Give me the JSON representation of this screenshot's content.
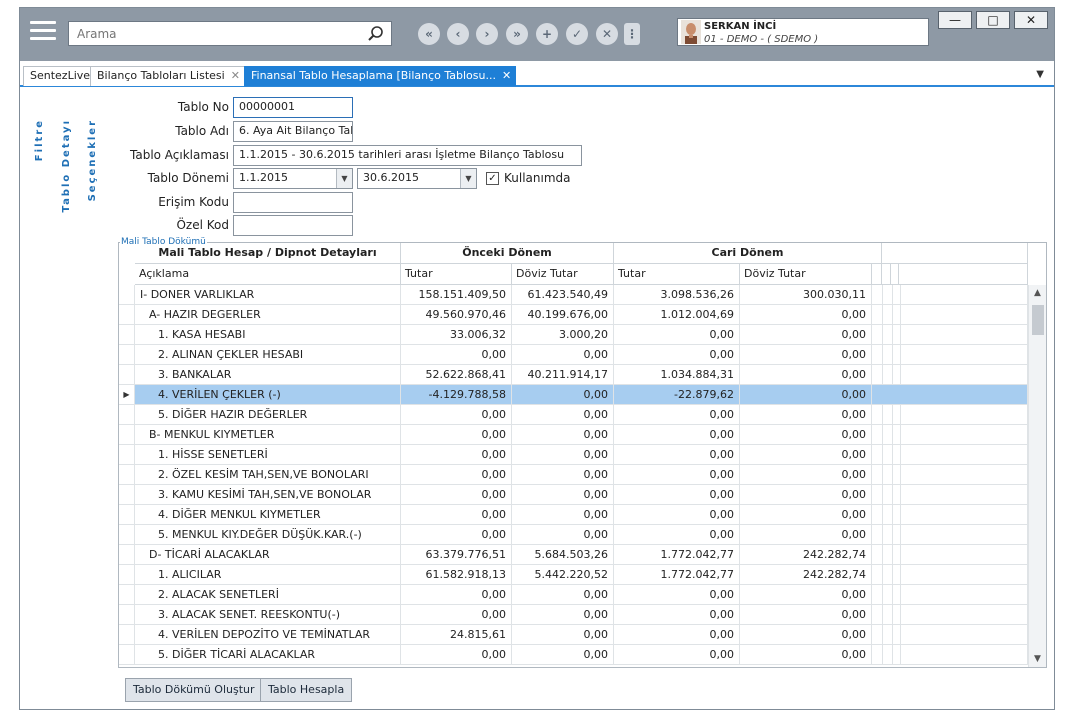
{
  "search": {
    "placeholder": "Arama"
  },
  "nav": {
    "first": "«",
    "prev": "‹",
    "next": "›",
    "last": "»",
    "add": "+",
    "confirm": "✓",
    "cancel": "✕",
    "menu": "⋮"
  },
  "user": {
    "name": "SERKAN İNCİ",
    "company": "01 - DEMO - ( SDEMO )"
  },
  "window": {
    "minimize": "—",
    "maximize": "□",
    "close": "✕"
  },
  "tabs": [
    {
      "label": "SentezLive",
      "closable": false
    },
    {
      "label": "Bilanço Tabloları Listesi",
      "closable": true
    },
    {
      "label": "Finansal Tablo Hesaplama  [Bilanço Tablosu...",
      "closable": true,
      "active": true
    }
  ],
  "tab_close_glyph": "✕",
  "tab_menu_glyph": "▼",
  "side_tabs": {
    "filter": "Filtre",
    "details": "Tablo Detayı",
    "options": "Seçenekler"
  },
  "form": {
    "no_label": "Tablo No",
    "no_value": "00000001",
    "name_label": "Tablo Adı",
    "name_value": "6. Aya Ait Bilanço Tab",
    "desc_label": "Tablo Açıklaması",
    "desc_value": "1.1.2015 - 30.6.2015 tarihleri arası İşletme Bilanço Tablosu",
    "period_label": "Tablo Dönemi",
    "period_start": "1.1.2015",
    "period_end": "30.6.2015",
    "in_use_label": "Kullanımda",
    "in_use_checked": true,
    "check_glyph": "✓",
    "access_label": "Erişim Kodu",
    "access_value": "",
    "special_label": "Özel Kod",
    "special_value": ""
  },
  "combo_arrow": "▼",
  "grid": {
    "caption": "Mali Tablo Dökümü",
    "band_main": "Mali Tablo Hesap / Dipnot Detayları",
    "band_prev": "Önceki Dönem",
    "band_curr": "Cari Dönem",
    "col_desc": "Açıklama",
    "col_amount": "Tutar",
    "col_fx": "Döviz Tutar",
    "row_indicator": "▶",
    "scroll_up": "▲",
    "scroll_down": "▼",
    "rows": [
      {
        "desc": "I- DONER VARLIKLAR",
        "indent": 0,
        "prev_amt": "158.151.409,50",
        "prev_fx": "61.423.540,49",
        "curr_amt": "3.098.536,26",
        "curr_fx": "300.030,11"
      },
      {
        "desc": "A- HAZIR DEGERLER",
        "indent": 1,
        "prev_amt": "49.560.970,46",
        "prev_fx": "40.199.676,00",
        "curr_amt": "1.012.004,69",
        "curr_fx": "0,00"
      },
      {
        "desc": "1. KASA HESABI",
        "indent": 2,
        "prev_amt": "33.006,32",
        "prev_fx": "3.000,20",
        "curr_amt": "0,00",
        "curr_fx": "0,00"
      },
      {
        "desc": "2. ALINAN ÇEKLER HESABI",
        "indent": 2,
        "prev_amt": "0,00",
        "prev_fx": "0,00",
        "curr_amt": "0,00",
        "curr_fx": "0,00"
      },
      {
        "desc": "3. BANKALAR",
        "indent": 2,
        "prev_amt": "52.622.868,41",
        "prev_fx": "40.211.914,17",
        "curr_amt": "1.034.884,31",
        "curr_fx": "0,00"
      },
      {
        "desc": "4. VERİLEN ÇEKLER (-)",
        "indent": 2,
        "prev_amt": "-4.129.788,58",
        "prev_fx": "0,00",
        "curr_amt": "-22.879,62",
        "curr_fx": "0,00",
        "selected": true
      },
      {
        "desc": "5. DİĞER HAZIR DEĞERLER",
        "indent": 2,
        "prev_amt": "0,00",
        "prev_fx": "0,00",
        "curr_amt": "0,00",
        "curr_fx": "0,00"
      },
      {
        "desc": "B- MENKUL KIYMETLER",
        "indent": 1,
        "prev_amt": "0,00",
        "prev_fx": "0,00",
        "curr_amt": "0,00",
        "curr_fx": "0,00"
      },
      {
        "desc": "1. HİSSE SENETLERİ",
        "indent": 2,
        "prev_amt": "0,00",
        "prev_fx": "0,00",
        "curr_amt": "0,00",
        "curr_fx": "0,00"
      },
      {
        "desc": "2. ÖZEL KESİM TAH,SEN,VE BONOLARI",
        "indent": 2,
        "prev_amt": "0,00",
        "prev_fx": "0,00",
        "curr_amt": "0,00",
        "curr_fx": "0,00"
      },
      {
        "desc": "3. KAMU KESİMİ TAH,SEN,VE BONOLAR",
        "indent": 2,
        "prev_amt": "0,00",
        "prev_fx": "0,00",
        "curr_amt": "0,00",
        "curr_fx": "0,00"
      },
      {
        "desc": "4. DİĞER MENKUL KIYMETLER",
        "indent": 2,
        "prev_amt": "0,00",
        "prev_fx": "0,00",
        "curr_amt": "0,00",
        "curr_fx": "0,00"
      },
      {
        "desc": "5. MENKUL KIY.DEĞER DÜŞÜK.KAR.(-)",
        "indent": 2,
        "prev_amt": "0,00",
        "prev_fx": "0,00",
        "curr_amt": "0,00",
        "curr_fx": "0,00"
      },
      {
        "desc": "D- TİCARİ ALACAKLAR",
        "indent": 1,
        "prev_amt": "63.379.776,51",
        "prev_fx": "5.684.503,26",
        "curr_amt": "1.772.042,77",
        "curr_fx": "242.282,74"
      },
      {
        "desc": "1. ALICILAR",
        "indent": 2,
        "prev_amt": "61.582.918,13",
        "prev_fx": "5.442.220,52",
        "curr_amt": "1.772.042,77",
        "curr_fx": "242.282,74"
      },
      {
        "desc": "2. ALACAK SENETLERİ",
        "indent": 2,
        "prev_amt": "0,00",
        "prev_fx": "0,00",
        "curr_amt": "0,00",
        "curr_fx": "0,00"
      },
      {
        "desc": "3. ALACAK SENET. REESKONTU(-)",
        "indent": 2,
        "prev_amt": "0,00",
        "prev_fx": "0,00",
        "curr_amt": "0,00",
        "curr_fx": "0,00"
      },
      {
        "desc": "4. VERİLEN DEPOZİTO VE TEMİNATLAR",
        "indent": 2,
        "prev_amt": "24.815,61",
        "prev_fx": "0,00",
        "curr_amt": "0,00",
        "curr_fx": "0,00"
      },
      {
        "desc": "5. DİĞER TİCARİ ALACAKLAR",
        "indent": 2,
        "prev_amt": "0,00",
        "prev_fx": "0,00",
        "curr_amt": "0,00",
        "curr_fx": "0,00"
      }
    ]
  },
  "buttons": {
    "generate": "Tablo Dökümü Oluştur",
    "calculate": "Tablo Hesapla"
  },
  "colors": {
    "titlebar": "#8e99a5",
    "accent": "#1e7fd6",
    "selection": "#a7cdf0"
  }
}
